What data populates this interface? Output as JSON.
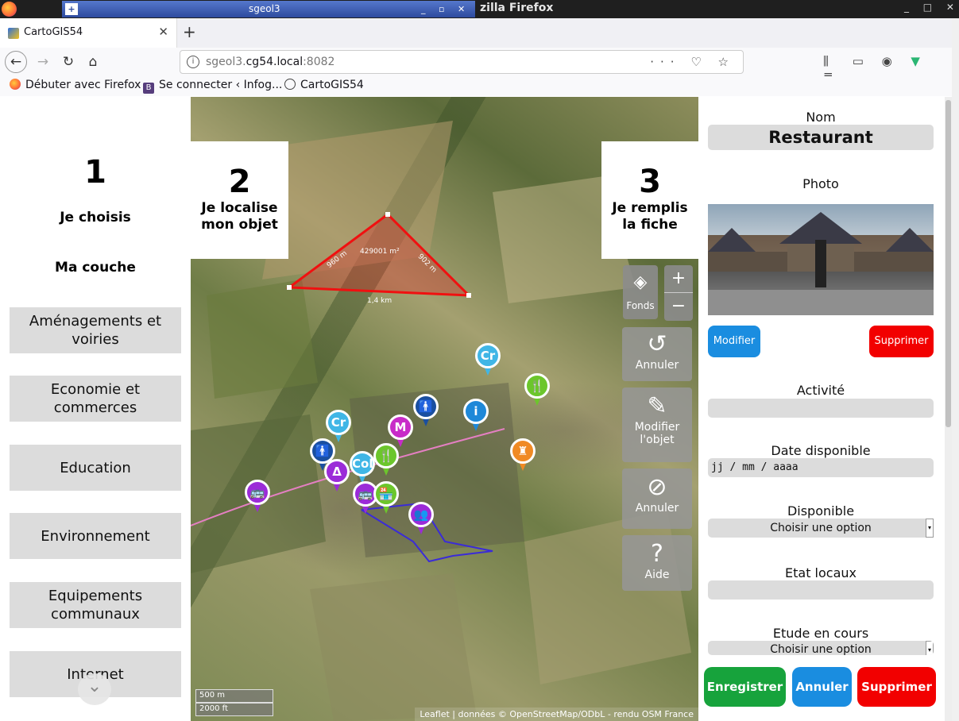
{
  "os": {
    "task_title": "sgeol3",
    "window_title": "zilla Firefox",
    "controls": "_ □ ✕"
  },
  "browser": {
    "tab_title": "CartoGIS54",
    "url_host_prefix": "sgeol3.",
    "url_host_main": "cg54.local",
    "url_port": ":8082",
    "bookmarks": [
      "Débuter avec Firefox",
      "Se connecter ‹ Infog...",
      "CartoGIS54"
    ]
  },
  "left": {
    "step_number": "1",
    "step_label": "Je choisis",
    "sub_label": "Ma couche",
    "layers": [
      "Aménagements et voiries",
      "Economie et commerces",
      "Education",
      "Environnement",
      "Equipements communaux",
      "Internet"
    ]
  },
  "map": {
    "step2_number": "2",
    "step2_label_1": "Je localise",
    "step2_label_2": "mon objet",
    "step3_number": "3",
    "step3_label_1": "Je remplis",
    "step3_label_2": "la fiche",
    "layer_switch_label": "Fonds",
    "zoom_in": "+",
    "zoom_out": "−",
    "tool_undo": "Annuler",
    "tool_edit_1": "Modifier",
    "tool_edit_2": "l'objet",
    "tool_cancel": "Annuler",
    "tool_help": "Aide",
    "measure_area": "429001 m²",
    "measure_side1": "960 m",
    "measure_side2": "902 m",
    "measure_base": "1,4 km",
    "scale_m": "500 m",
    "scale_ft": "2000 ft",
    "attribution": "Leaflet | données © OpenStreetMap/ODbL - rendu OSM France",
    "markers": [
      {
        "label": "Cr",
        "color": "#40b6e6"
      },
      {
        "label": "🍴",
        "color": "#6cc62c"
      },
      {
        "label": "i",
        "color": "#1e88d8"
      },
      {
        "label": "🚹",
        "color": "#1a4fa0"
      },
      {
        "label": "M",
        "color": "#c82bc8"
      },
      {
        "label": "Cr",
        "color": "#40b6e6"
      },
      {
        "label": "🚹",
        "color": "#1a4fa0"
      },
      {
        "label": "♜",
        "color": "#f08a24"
      },
      {
        "label": "Δ",
        "color": "#9b2bd8"
      },
      {
        "label": "Col",
        "color": "#40b6e6"
      },
      {
        "label": "🍴",
        "color": "#6cc62c"
      },
      {
        "label": "🚌",
        "color": "#9b2bd8"
      },
      {
        "label": "🚌",
        "color": "#9b2bd8"
      },
      {
        "label": "🏪",
        "color": "#6cc62c"
      },
      {
        "label": "👥",
        "color": "#9b2bd8"
      }
    ]
  },
  "form": {
    "nom_label": "Nom",
    "nom_value": "Restaurant",
    "photo_label": "Photo",
    "modify_button": "Modifier",
    "delete_photo_button": "Supprimer",
    "activite_label": "Activité",
    "activite_value": "",
    "date_label": "Date disponible",
    "date_value": "jj / mm / aaaa",
    "disponible_label": "Disponible",
    "disponible_value": "Choisir une option",
    "etat_label": "Etat locaux",
    "etat_value": "",
    "etude_label": "Etude en cours",
    "etude_value": "Choisir une option",
    "save_button": "Enregistrer",
    "cancel_button": "Annuler",
    "delete_button": "Supprimer"
  }
}
